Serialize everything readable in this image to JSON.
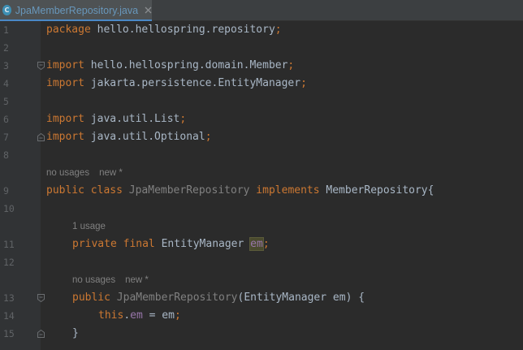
{
  "tab": {
    "file_name": "JpaMemberRepository.java",
    "icon_letter": "C",
    "close": "×"
  },
  "gutter": {
    "line_numbers": [
      "1",
      "2",
      "3",
      "4",
      "5",
      "6",
      "7",
      "8",
      "9",
      "10",
      "11",
      "12",
      "13",
      "14",
      "15"
    ]
  },
  "code": {
    "line1": {
      "kw": "package",
      "rest": " hello.hellospring.repository",
      "end": ";"
    },
    "line3": {
      "kw": "import",
      "rest": " hello.hellospring.domain.Member",
      "end": ";"
    },
    "line4": {
      "kw": "import",
      "rest": " jakarta.persistence.EntityManager",
      "end": ";"
    },
    "line6": {
      "kw": "import",
      "rest": " java.util.List",
      "end": ";"
    },
    "line7": {
      "kw": "import",
      "rest": " java.util.Optional",
      "end": ";"
    },
    "hint9": {
      "usages": "no usages",
      "status": "new *"
    },
    "line9": {
      "kw1": "public",
      "kw2": " class",
      "cls": " JpaMemberRepository",
      "kw3": " implements",
      "iface": " MemberRepository",
      "brace": "{"
    },
    "hint11": {
      "usages": "1 usage"
    },
    "line11": {
      "kw1": "private",
      "kw2": " final",
      "type": " EntityManager",
      "space": " ",
      "field": "em",
      "end": ";"
    },
    "hint13": {
      "usages": "no usages",
      "status": "new *"
    },
    "line13": {
      "kw1": "public",
      "cls": " JpaMemberRepository",
      "params": "(EntityManager em) {"
    },
    "line14": {
      "kw": "this",
      "dot": ".",
      "field": "em",
      "rest": " = em",
      "end": ";"
    },
    "line15": {
      "brace": "}"
    }
  },
  "colors": {
    "background": "#2b2b2b",
    "keyword": "#cc7832",
    "field": "#9876aa",
    "text": "#a9b7c6",
    "tab_underline": "#4a88c7"
  }
}
